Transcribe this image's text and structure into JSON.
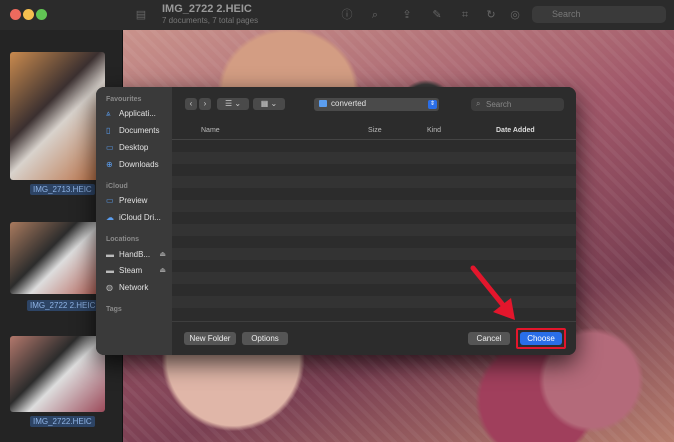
{
  "window": {
    "title": "IMG_2722 2.HEIC",
    "subtitle": "7 documents, 7 total pages",
    "search_placeholder": "Search"
  },
  "thumbnails": [
    {
      "label": "IMG_2713.HEIC"
    },
    {
      "label": "IMG_2722 2.HEIC"
    },
    {
      "label": "IMG_2722.HEIC"
    }
  ],
  "dialog": {
    "sidebar": {
      "favourites_heading": "Favourites",
      "favourites": [
        "Applicati...",
        "Documents",
        "Desktop",
        "Downloads"
      ],
      "icloud_heading": "iCloud",
      "icloud": [
        "Preview",
        "iCloud Dri..."
      ],
      "locations_heading": "Locations",
      "locations": [
        "HandB...",
        "Steam",
        "Network"
      ],
      "tags_heading": "Tags"
    },
    "toolbar": {
      "back": "‹",
      "forward": "›",
      "view_list": "☰ ⌄",
      "view_grid": "▦ ⌄",
      "path_label": "converted",
      "search_placeholder": "Search"
    },
    "columns": {
      "name": "Name",
      "size": "Size",
      "kind": "Kind",
      "date_added": "Date Added"
    },
    "footer": {
      "new_folder": "New Folder",
      "options": "Options",
      "cancel": "Cancel",
      "choose": "Choose"
    }
  },
  "colors": {
    "accent": "#2a6ee8",
    "highlight": "#e3162c"
  }
}
